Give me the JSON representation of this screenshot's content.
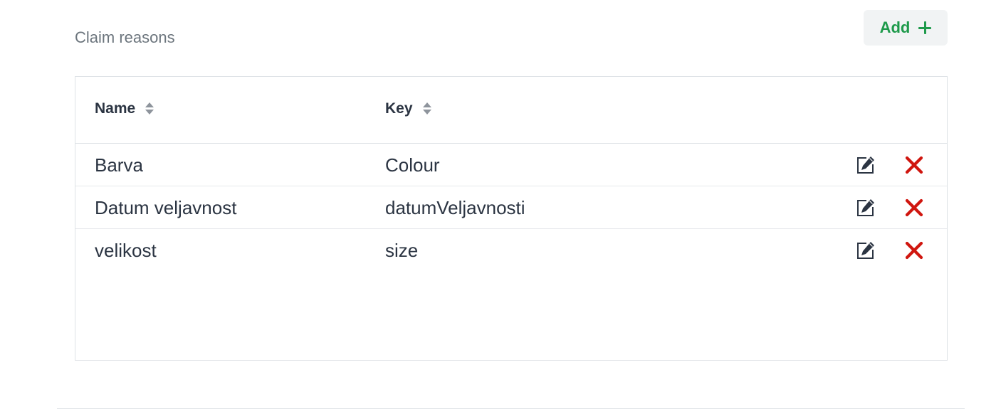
{
  "header": {
    "title": "Claim reasons",
    "add_label": "Add"
  },
  "table": {
    "columns": [
      {
        "label": "Name",
        "sortable": true
      },
      {
        "label": "Key",
        "sortable": true
      }
    ],
    "rows": [
      {
        "name": "Barva",
        "key": "Colour"
      },
      {
        "name": "Datum veljavnost",
        "key": "datumVeljavnosti"
      },
      {
        "name": "velikost",
        "key": "size"
      }
    ]
  },
  "icons": {
    "add": "plus-icon",
    "sort": "sort-icon",
    "edit": "edit-icon",
    "delete": "delete-icon"
  },
  "colors": {
    "accent_green": "#1e9a4b",
    "delete_red": "#d0160f",
    "text": "#2b3442",
    "muted": "#6c757d"
  }
}
